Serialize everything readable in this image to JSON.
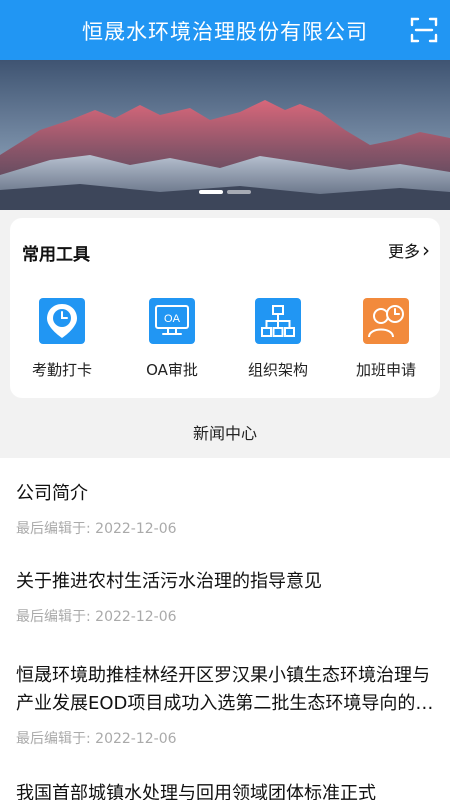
{
  "header": {
    "title": "恒晟水环境治理股份有限公司",
    "scan_icon": "scan-icon"
  },
  "banner": {
    "slides": 2,
    "active_slide": 1
  },
  "tools": {
    "title": "常用工具",
    "more_label": "更多",
    "items": [
      {
        "label": "考勤打卡",
        "icon": "location-clock-icon",
        "color": "#2196f3"
      },
      {
        "label": "OA审批",
        "icon": "oa-monitor-icon",
        "color": "#2196f3"
      },
      {
        "label": "组织架构",
        "icon": "org-chart-icon",
        "color": "#2196f3"
      },
      {
        "label": "加班申请",
        "icon": "user-clock-icon",
        "color": "#f28a3c"
      }
    ],
    "oa_text": "OA"
  },
  "news": {
    "section_title": "新闻中心",
    "meta_prefix": "最后编辑于:",
    "items": [
      {
        "title": "公司简介",
        "meta": "最后编辑于:  2022-12-06"
      },
      {
        "title": "关于推进农村生活污水治理的指导意见",
        "meta": "最后编辑于:  2022-12-06"
      },
      {
        "title": "恒晟环境助推桂林经开区罗汉果小镇生态环境治理与产业发展EOD项目成功入选第二批生态环境导向的开发模式试点",
        "meta": "最后编辑于:  2022-12-06"
      },
      {
        "title": "我国首部城镇水处理与回用领域团体标准正式",
        "meta": ""
      }
    ]
  }
}
